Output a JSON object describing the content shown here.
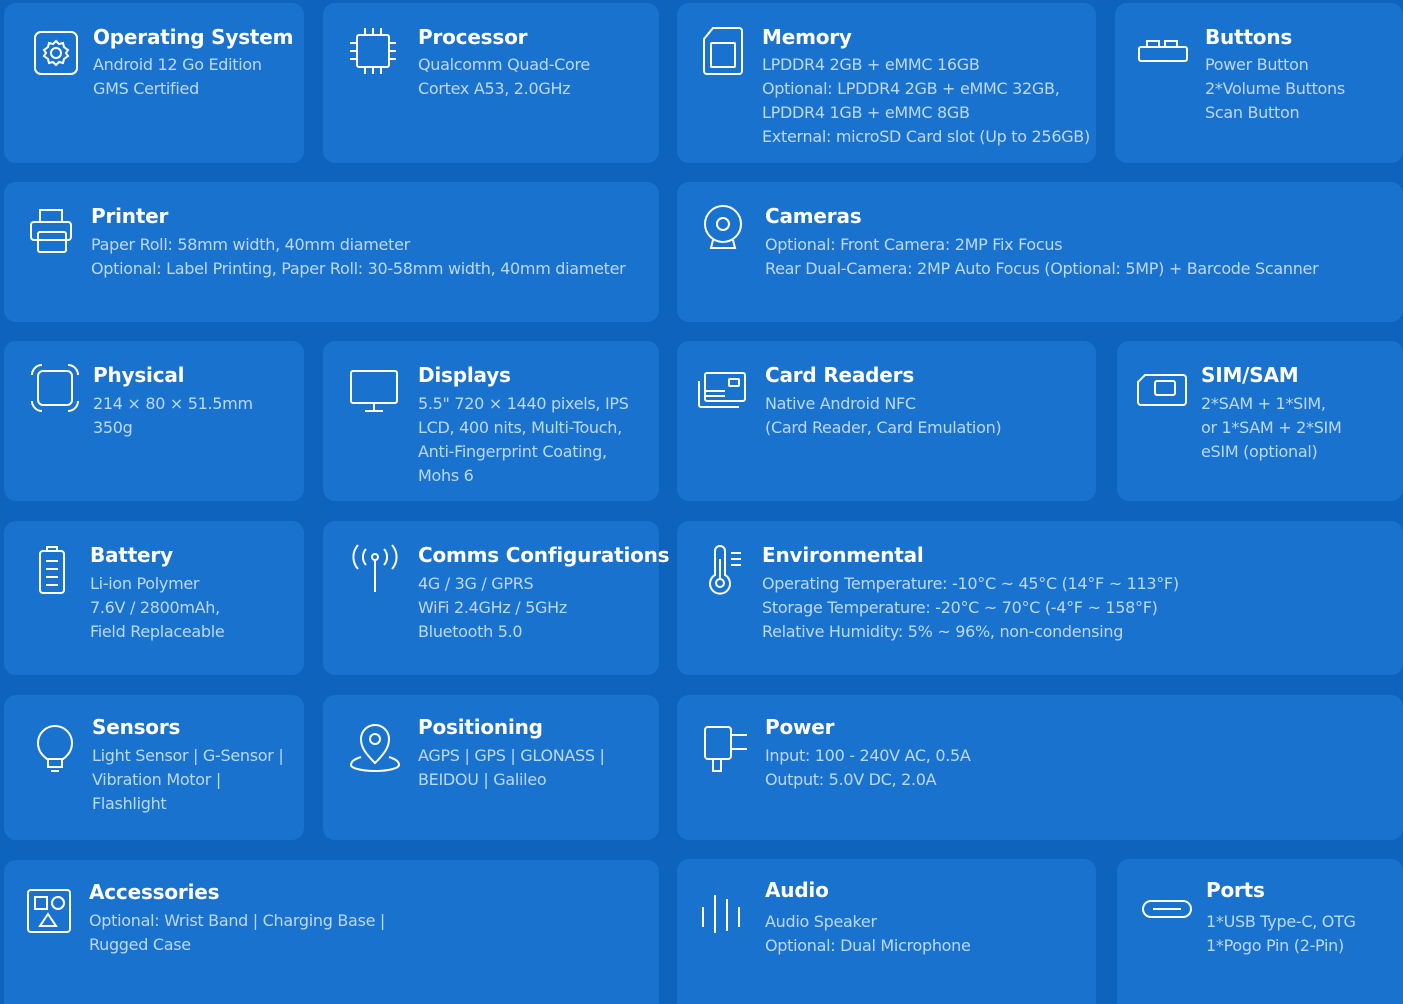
{
  "cards": {
    "os": {
      "title": "Operating System",
      "lines": [
        "Android 12 Go Edition",
        "GMS Certified"
      ]
    },
    "processor": {
      "title": "Processor",
      "lines": [
        "Qualcomm Quad-Core",
        "Cortex A53, 2.0GHz"
      ]
    },
    "memory": {
      "title": "Memory",
      "lines": [
        "LPDDR4 2GB + eMMC 16GB",
        "Optional:  LPDDR4 2GB + eMMC 32GB,",
        "LPDDR4 1GB + eMMC 8GB",
        "External:  microSD Card slot (Up to 256GB)"
      ]
    },
    "buttons": {
      "title": "Buttons",
      "lines": [
        "Power Button",
        "2*Volume Buttons",
        "Scan Button"
      ]
    },
    "printer": {
      "title": "Printer",
      "lines": [
        "Paper Roll:  58mm width, 40mm diameter",
        "Optional:  Label Printing, Paper Roll:  30-58mm width, 40mm diameter"
      ]
    },
    "cameras": {
      "title": "Cameras",
      "lines": [
        "Optional:  Front Camera:  2MP Fix Focus",
        "Rear Dual-Camera:  2MP Auto Focus (Optional: 5MP) + Barcode Scanner"
      ]
    },
    "physical": {
      "title": "Physical",
      "lines": [
        "214 × 80 × 51.5mm",
        "350g"
      ]
    },
    "displays": {
      "title": "Displays",
      "lines": [
        "5.5\" 720 × 1440 pixels, IPS",
        "LCD, 400 nits, Multi-Touch,",
        "Anti-Fingerprint Coating,",
        "Mohs 6"
      ]
    },
    "card_readers": {
      "title": "Card Readers",
      "lines": [
        "Native Android NFC",
        "(Card Reader, Card Emulation)"
      ]
    },
    "sim": {
      "title": "SIM/SAM",
      "lines": [
        "2*SAM + 1*SIM,",
        "or 1*SAM + 2*SIM",
        "eSIM (optional)"
      ]
    },
    "battery": {
      "title": "Battery",
      "lines": [
        "Li-ion Polymer",
        "7.6V / 2800mAh,",
        "Field Replaceable"
      ]
    },
    "comms": {
      "title": "Comms Configurations",
      "lines": [
        "4G / 3G / GPRS",
        "WiFi 2.4GHz / 5GHz",
        "Bluetooth 5.0"
      ]
    },
    "environmental": {
      "title": "Environmental",
      "lines": [
        "Operating Temperature:  -10°C ~ 45°C (14°F ~ 113°F)",
        "Storage Temperature:  -20°C ~ 70°C (-4°F ~ 158°F)",
        "Relative Humidity:  5% ~ 96%, non-condensing"
      ]
    },
    "sensors": {
      "title": "Sensors",
      "lines": [
        "Light Sensor | G-Sensor |",
        "Vibration Motor |",
        "Flashlight"
      ]
    },
    "positioning": {
      "title": "Positioning",
      "lines": [
        "AGPS | GPS | GLONASS |",
        "BEIDOU | Galileo"
      ]
    },
    "power": {
      "title": "Power",
      "lines": [
        "Input:  100 - 240V AC, 0.5A",
        "Output:  5.0V DC, 2.0A"
      ]
    },
    "accessories": {
      "title": "Accessories",
      "lines": [
        "Optional:  Wrist Band | Charging Base |",
        "Rugged Case"
      ]
    },
    "audio": {
      "title": "Audio",
      "lines": [
        "Audio Speaker",
        "Optional:  Dual Microphone"
      ]
    },
    "ports": {
      "title": "Ports",
      "lines": [
        "1*USB Type-C, OTG",
        "1*Pogo Pin (2-Pin)"
      ]
    }
  },
  "icons": {
    "os": "gear-icon",
    "processor": "chip-icon",
    "memory": "memory-card-icon",
    "buttons": "button-icon",
    "printer": "printer-icon",
    "cameras": "webcam-icon",
    "physical": "dimensions-icon",
    "displays": "monitor-icon",
    "card_readers": "card-reader-icon",
    "sim": "sim-card-icon",
    "battery": "battery-icon",
    "comms": "antenna-icon",
    "environmental": "thermometer-icon",
    "sensors": "lightbulb-icon",
    "positioning": "location-pin-icon",
    "power": "plug-icon",
    "accessories": "accessories-icon",
    "audio": "sound-bars-icon",
    "ports": "usb-port-icon"
  },
  "colors": {
    "background": "#0e63bd",
    "card": "#1a72cf",
    "title": "#ffffff",
    "text": "#bcd9fb",
    "icon": "#ffffff"
  }
}
